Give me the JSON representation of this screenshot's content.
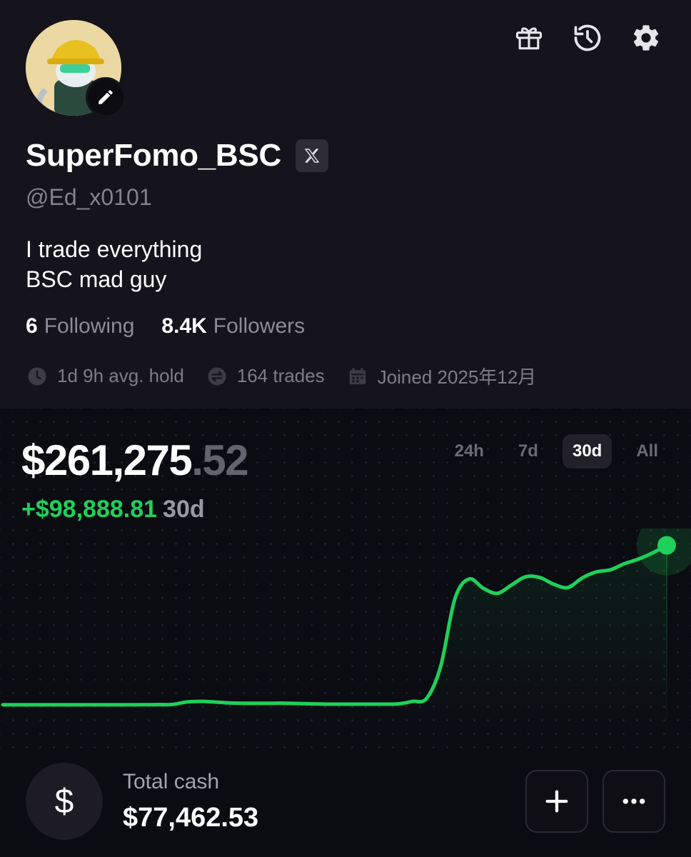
{
  "profile": {
    "display_name": "SuperFomo_BSC",
    "handle": "@Ed_x0101",
    "bio_line1": "I trade everything",
    "bio_line2": "BSC mad guy",
    "following_count": "6",
    "following_label": "Following",
    "followers_count": "8.4K",
    "followers_label": "Followers",
    "avg_hold": "1d 9h avg. hold",
    "trades": "164 trades",
    "joined": "Joined 2025年12月"
  },
  "header_icons": [
    "gift-icon",
    "history-icon",
    "gear-icon"
  ],
  "portfolio": {
    "balance_whole": "$261,275",
    "balance_cents": ".52",
    "change": "+$98,888.81",
    "change_period": "30d",
    "ranges": [
      "24h",
      "7d",
      "30d",
      "All"
    ],
    "active_range": "30d"
  },
  "colors": {
    "accent_green": "#1fd05a",
    "background": "#0b0b12",
    "profile_background": "#15141c"
  },
  "chart_data": {
    "type": "line",
    "title": "",
    "xlabel": "",
    "ylabel": "",
    "series": [
      {
        "values": [
          162387,
          162387,
          162387,
          162387,
          162387,
          162387,
          162387,
          162387,
          162387,
          162400,
          162420,
          162450,
          162500,
          163300,
          163500,
          163300,
          163000,
          162900,
          162900,
          162900,
          162900,
          162800,
          162700,
          162600,
          162600,
          162600,
          162600,
          162600,
          162700,
          163500,
          164500,
          175000,
          197000,
          203500,
          200500,
          198800,
          201500,
          204200,
          204000,
          201800,
          200700,
          203800,
          205800,
          206500,
          208500,
          210000,
          212000,
          214500
        ]
      }
    ],
    "ylim": [
      150000,
      220000
    ],
    "grid": false
  },
  "cash": {
    "label": "Total cash",
    "value": "$77,462.53",
    "currency_symbol": "$"
  }
}
